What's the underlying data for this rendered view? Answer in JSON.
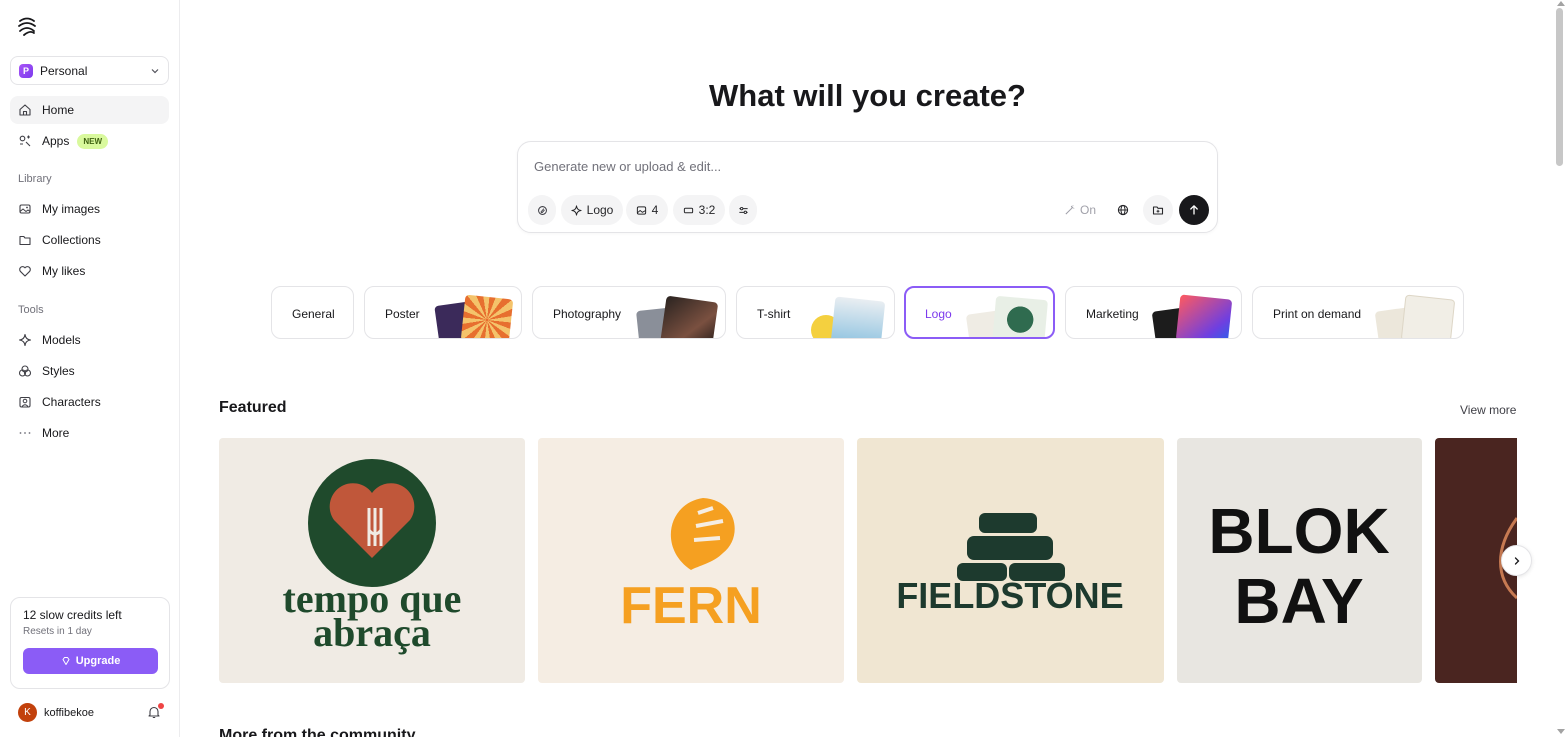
{
  "sidebar": {
    "workspace": {
      "initial": "P",
      "name": "Personal"
    },
    "nav_main": [
      {
        "label": "Home",
        "icon": "home-icon",
        "active": true
      },
      {
        "label": "Apps",
        "icon": "apps-icon",
        "badge": "NEW"
      }
    ],
    "library_label": "Library",
    "library_items": [
      {
        "label": "My images",
        "icon": "images-icon"
      },
      {
        "label": "Collections",
        "icon": "folder-icon"
      },
      {
        "label": "My likes",
        "icon": "heart-icon"
      }
    ],
    "tools_label": "Tools",
    "tools_items": [
      {
        "label": "Models",
        "icon": "sparkle-icon"
      },
      {
        "label": "Styles",
        "icon": "styles-icon"
      },
      {
        "label": "Characters",
        "icon": "characters-icon"
      },
      {
        "label": "More",
        "icon": "more-dots-icon"
      }
    ],
    "credits": {
      "title": "12 slow credits left",
      "subtitle": "Resets in 1 day",
      "upgrade_label": "Upgrade"
    },
    "user": {
      "initial": "K",
      "name": "koffibekoe"
    }
  },
  "main": {
    "headline": "What will you create?",
    "prompt": {
      "placeholder": "Generate new or upload & edit...",
      "value": "",
      "type_chip": "Logo",
      "count_chip": "4",
      "ratio_chip": "3:2",
      "magic_toggle": "On"
    },
    "categories": [
      {
        "label": "General"
      },
      {
        "label": "Poster"
      },
      {
        "label": "Photography"
      },
      {
        "label": "T-shirt"
      },
      {
        "label": "Logo",
        "selected": true
      },
      {
        "label": "Marketing"
      },
      {
        "label": "Print on demand"
      }
    ],
    "featured": {
      "title": "Featured",
      "view_more": "View more",
      "cards": [
        {
          "name": "tempo-que-abraca",
          "line1": "tempo que",
          "line2": "abraça",
          "bg": "#f0ebe4",
          "fg": "#1f4a2c",
          "accent": "#c0573a"
        },
        {
          "name": "fern",
          "text": "FERN",
          "bg": "#f5ede3",
          "fg": "#f5a021"
        },
        {
          "name": "fieldstone",
          "text": "FIELDSTONE",
          "bg": "#f0e6d2",
          "fg": "#1d3a2e"
        },
        {
          "name": "blok-bay",
          "line1": "BLOK",
          "line2": "BAY",
          "bg": "#e8e6e1",
          "fg": "#111111"
        },
        {
          "name": "brown-partial",
          "bg": "#4a2520",
          "fg": "#c77a52"
        }
      ]
    },
    "community_title": "More from the community"
  },
  "colors": {
    "accent": "#8b5cf6",
    "new_badge": "#d9f99d"
  }
}
